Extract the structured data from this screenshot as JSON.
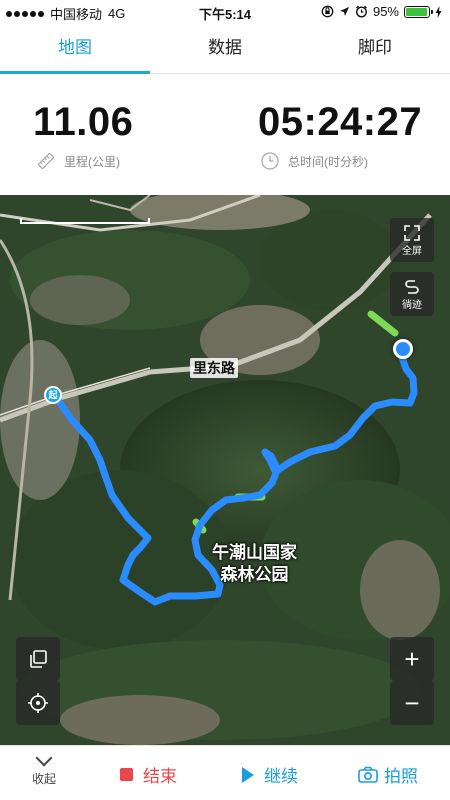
{
  "status_bar": {
    "carrier": "中国移动",
    "network": "4G",
    "time": "下午5:14",
    "battery_percent": "95%",
    "battery_level": 0.95,
    "icons": [
      "signal-icon",
      "orientation-lock-icon",
      "location-icon",
      "alarm-icon",
      "battery-icon",
      "charging-icon"
    ]
  },
  "tabs": [
    {
      "label": "地图",
      "active": true
    },
    {
      "label": "数据",
      "active": false
    },
    {
      "label": "脚印",
      "active": false
    }
  ],
  "stats": {
    "distance_value": "11.06",
    "distance_label": "里程(公里)",
    "distance_icon": "ruler-icon",
    "time_value": "05:24:27",
    "time_label": "总时间(时分秒)",
    "time_icon": "clock-icon"
  },
  "map": {
    "road_label": "里东路",
    "park_label_line1": "午潮山国家",
    "park_label_line2": "森林公园",
    "start_marker": "起",
    "fullscreen_label": "全屏",
    "track_label": "徜迹",
    "route_color": "#2a8cff",
    "route_highlight_color": "#7ed957"
  },
  "controls": {
    "collapse_label": "收起",
    "end_label": "结束",
    "continue_label": "继续",
    "photo_label": "拍照"
  },
  "colors": {
    "accent": "#1a9fdc",
    "end_red": "#e8474c"
  }
}
